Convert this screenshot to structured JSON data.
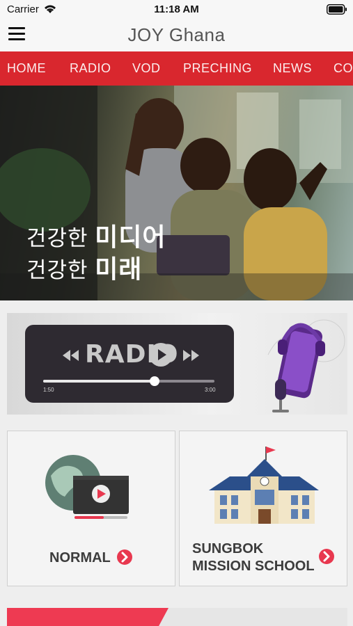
{
  "status_bar": {
    "carrier": "Carrier",
    "time": "11:18 AM"
  },
  "nav": {
    "title": "JOY Ghana"
  },
  "tabs": [
    {
      "label": "HOME"
    },
    {
      "label": "RADIO"
    },
    {
      "label": "VOD"
    },
    {
      "label": "PRECHING"
    },
    {
      "label": "NEWS"
    },
    {
      "label": "CO"
    }
  ],
  "hero": {
    "line1_prefix": "건강한",
    "line1_bold": "미디어",
    "line2_prefix": "건강한",
    "line2_bold": "미래"
  },
  "radio_banner": {
    "label": "RADIO",
    "time_start": "1:50",
    "time_end": "3:00",
    "progress": 0.65
  },
  "cards": {
    "normal": {
      "label": "NORMAL"
    },
    "school": {
      "line1": "SUNGBOK",
      "line2": "MISSION SCHOOL"
    }
  },
  "colors": {
    "tab_bar": "#d9272e",
    "accent": "#e8384f"
  },
  "icons": [
    "menu-icon",
    "wifi-icon",
    "battery-icon",
    "rewind-icon",
    "play-icon",
    "fast-forward-icon",
    "arrow-right-icon"
  ]
}
